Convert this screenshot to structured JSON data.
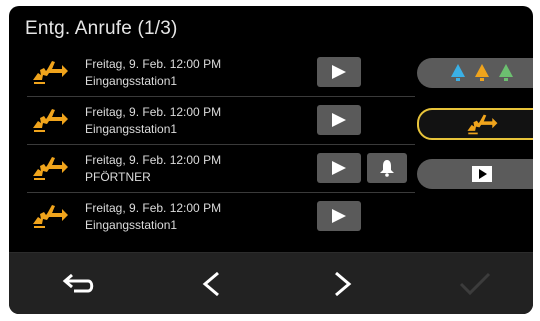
{
  "header": {
    "title": "Entg. Anrufe (1/3)"
  },
  "calls": [
    {
      "datetime": "Freitag, 9. Feb. 12:00 PM",
      "station": "Eingangsstation1",
      "has_bell": false
    },
    {
      "datetime": "Freitag, 9. Feb. 12:00 PM",
      "station": "Eingangsstation1",
      "has_bell": false
    },
    {
      "datetime": "Freitag, 9. Feb. 12:00 PM",
      "station": "PFÖRTNER",
      "has_bell": true
    },
    {
      "datetime": "Freitag, 9. Feb. 12:00 PM",
      "station": "Eingangsstation1",
      "has_bell": false
    }
  ],
  "side_filters": [
    {
      "name": "all-calls-filter",
      "icon": "three-bells-icon",
      "selected": false
    },
    {
      "name": "missed-calls-filter",
      "icon": "missed-call-icon",
      "selected": true
    },
    {
      "name": "recorded-calls-filter",
      "icon": "video-play-icon",
      "selected": false
    }
  ],
  "colors": {
    "accent_orange": "#f0a41c",
    "selected_border": "#e8c43a",
    "bell_blue": "#3ab0e6",
    "bell_orange": "#f0a41c",
    "bell_green": "#6cc070"
  },
  "footer": {
    "back_icon": "back-arrow-icon",
    "prev_icon": "chevron-left-icon",
    "next_icon": "chevron-right-icon",
    "confirm_icon": "checkmark-icon"
  }
}
